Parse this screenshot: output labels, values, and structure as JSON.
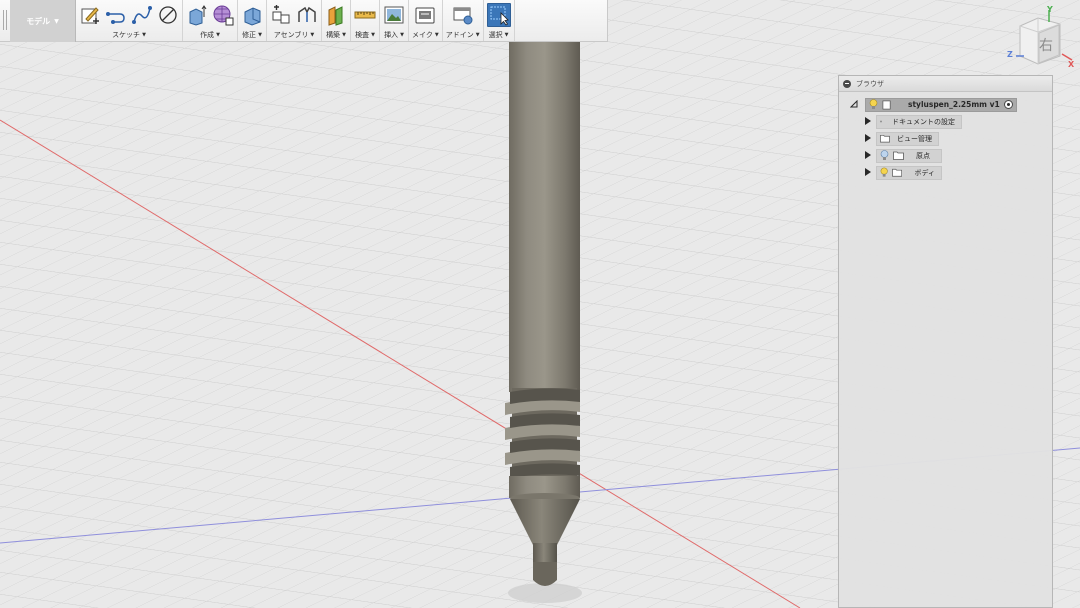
{
  "toolbar": {
    "workspace_label": "モデル",
    "groups": [
      {
        "id": "sketch",
        "label": "スケッチ"
      },
      {
        "id": "create",
        "label": "作成"
      },
      {
        "id": "modify",
        "label": "修正"
      },
      {
        "id": "assemble",
        "label": "アセンブリ"
      },
      {
        "id": "construct",
        "label": "構築"
      },
      {
        "id": "inspect",
        "label": "検査"
      },
      {
        "id": "insert",
        "label": "挿入"
      },
      {
        "id": "make",
        "label": "メイク"
      },
      {
        "id": "addins",
        "label": "アドイン"
      },
      {
        "id": "select",
        "label": "選択"
      }
    ]
  },
  "viewcube": {
    "face_label": "右",
    "axis_y": "Y",
    "axis_z": "Z",
    "axis_x": "X"
  },
  "browser": {
    "title": "ブラウザ",
    "root": {
      "label": "styluspen_2.25mm v1"
    },
    "items": [
      {
        "label": "ドキュメントの設定",
        "icon": "gear-icon"
      },
      {
        "label": "ビュー管理",
        "icon": "folder-icon"
      },
      {
        "label": "原点",
        "icon": "folder-icon",
        "visibility": "light-bulb-off-icon"
      },
      {
        "label": "ボディ",
        "icon": "folder-icon",
        "visibility": "light-bulb-on-icon"
      }
    ]
  },
  "colors": {
    "toolbar_bg": "#f4f4f4",
    "grid_bg": "#e9e9e9",
    "grid_line": "#c9c9c9",
    "x_axis": "#e05858",
    "z_axis": "#8a8ad8",
    "body_gray": "#868276",
    "select_blue": "#3b76b8",
    "panel_bg": "#e2e2e2"
  }
}
